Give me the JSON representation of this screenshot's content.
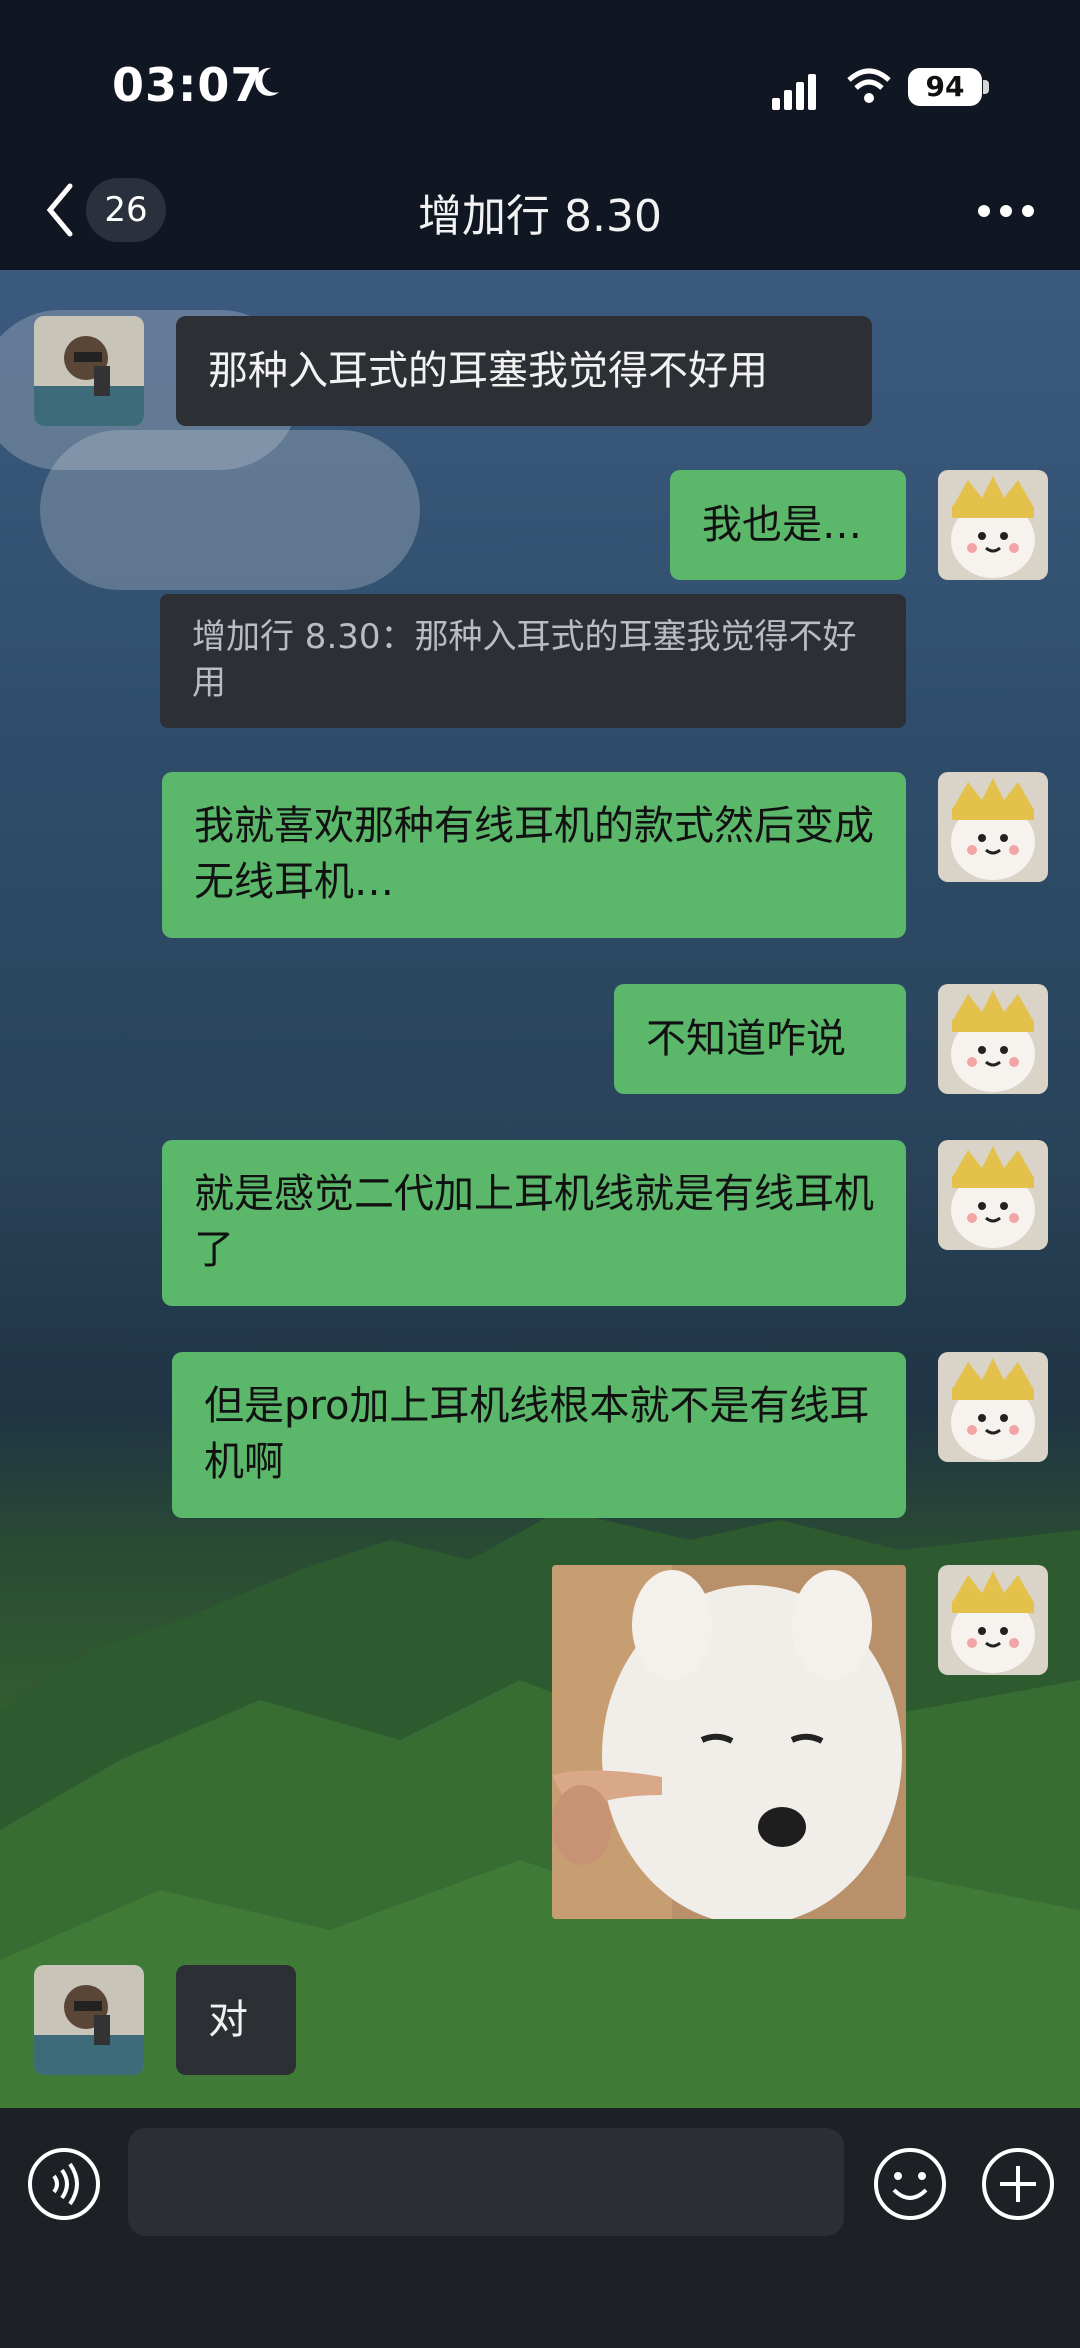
{
  "status_bar": {
    "time": "03:07",
    "battery": "94"
  },
  "header": {
    "unread_count": "26",
    "title": "增加行 8.30"
  },
  "messages": [
    {
      "side": "left",
      "text": "那种入耳式的耳塞我觉得不好用"
    },
    {
      "side": "right",
      "text": "我也是…"
    },
    {
      "side": "quote",
      "text": "增加行 8.30：那种入耳式的耳塞我觉得不好用"
    },
    {
      "side": "right",
      "text": "我就喜欢那种有线耳机的款式然后变成无线耳机…"
    },
    {
      "side": "right",
      "text": "不知道咋说"
    },
    {
      "side": "right",
      "text": "就是感觉二代加上耳机线就是有线耳机了"
    },
    {
      "side": "right",
      "text": "但是pro加上耳机线根本就不是有线耳机啊"
    },
    {
      "side": "right",
      "type": "sticker",
      "icon": "samoyed-sticker"
    },
    {
      "side": "left",
      "text": "对"
    }
  ],
  "colors": {
    "green_bubble": "#5bb86b",
    "dark_bubble": "#2c2f34",
    "header_bg": "#111722"
  }
}
